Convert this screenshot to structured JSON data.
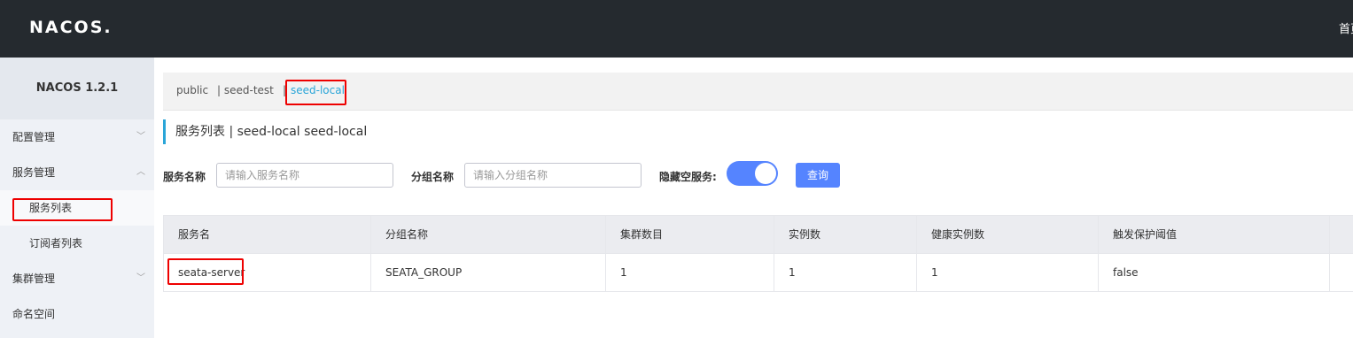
{
  "header": {
    "logo": "NACOS.",
    "nav_home": "首页"
  },
  "sidebar": {
    "version": "NACOS 1.2.1",
    "items": [
      {
        "label": "配置管理",
        "chevron": "﹀"
      },
      {
        "label": "服务管理",
        "chevron": "︿"
      },
      {
        "label": "服务列表"
      },
      {
        "label": "订阅者列表"
      },
      {
        "label": "集群管理",
        "chevron": "﹀"
      },
      {
        "label": "命名空间"
      }
    ]
  },
  "namespaces": [
    "public",
    "| seed-test",
    "|",
    "seed-local"
  ],
  "page": {
    "title": "服务列表  |  seed-local  seed-local"
  },
  "filters": {
    "service_label": "服务名称",
    "service_placeholder": "请输入服务名称",
    "group_label": "分组名称",
    "group_placeholder": "请输入分组名称",
    "hide_empty_label": "隐藏空服务:",
    "hide_empty_on": true,
    "query_button": "查询"
  },
  "table": {
    "headers": [
      "服务名",
      "分组名称",
      "集群数目",
      "实例数",
      "健康实例数",
      "触发保护阈值"
    ],
    "rows": [
      [
        "seata-server",
        "SEATA_GROUP",
        "1",
        "1",
        "1",
        "false"
      ]
    ]
  },
  "colors": {
    "accent": "#2aa5d8",
    "primary": "#5584ff",
    "highlight": "#ee0000"
  }
}
